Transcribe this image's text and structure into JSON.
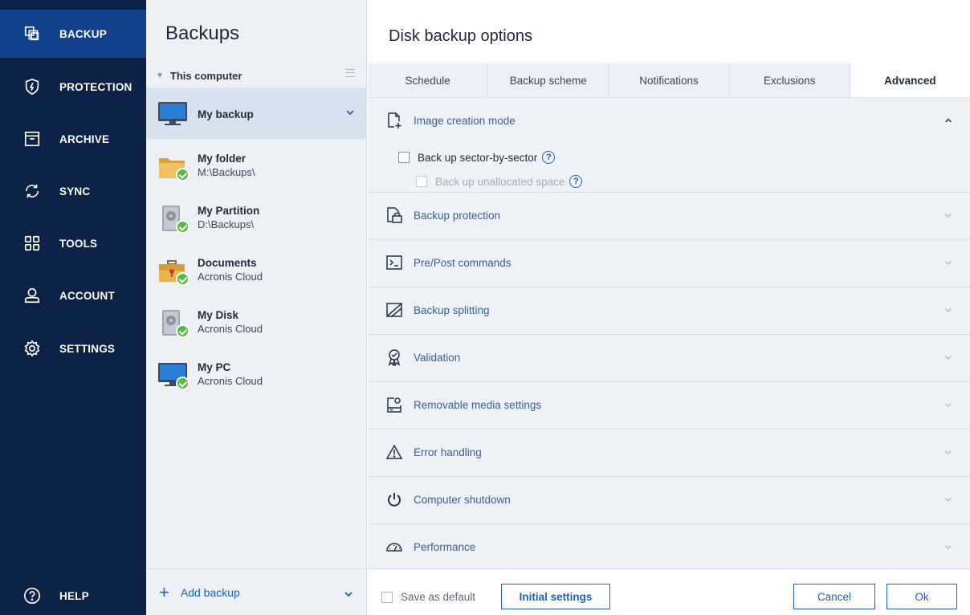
{
  "nav": {
    "items": [
      {
        "label": "BACKUP",
        "icon": "backup-icon"
      },
      {
        "label": "PROTECTION",
        "icon": "shield-icon"
      },
      {
        "label": "ARCHIVE",
        "icon": "archive-box-icon"
      },
      {
        "label": "SYNC",
        "icon": "sync-icon"
      },
      {
        "label": "TOOLS",
        "icon": "tools-grid-icon"
      },
      {
        "label": "ACCOUNT",
        "icon": "user-icon"
      },
      {
        "label": "SETTINGS",
        "icon": "gear-icon"
      }
    ],
    "help": {
      "label": "HELP",
      "icon": "help-circle-icon"
    }
  },
  "backups": {
    "title": "Backups",
    "group": "This computer",
    "items": [
      {
        "name": "My backup",
        "sub": "",
        "type": "monitor"
      },
      {
        "name": "My folder",
        "sub": "M:\\Backups\\",
        "type": "folder"
      },
      {
        "name": "My Partition",
        "sub": "D:\\Backups\\",
        "type": "disk"
      },
      {
        "name": "Documents",
        "sub": "Acronis Cloud",
        "type": "briefcase"
      },
      {
        "name": "My Disk",
        "sub": "Acronis Cloud",
        "type": "disk"
      },
      {
        "name": "My PC",
        "sub": "Acronis Cloud",
        "type": "monitor"
      }
    ],
    "add_label": "Add backup"
  },
  "panel": {
    "title": "Disk backup options",
    "tabs": [
      "Schedule",
      "Backup scheme",
      "Notifications",
      "Exclusions",
      "Advanced"
    ],
    "active_tab": "Advanced",
    "sections": [
      {
        "label": "Image creation mode",
        "icon": "image-add-icon"
      },
      {
        "label": "Backup protection",
        "icon": "lock-file-icon"
      },
      {
        "label": "Pre/Post commands",
        "icon": "terminal-icon"
      },
      {
        "label": "Backup splitting",
        "icon": "split-icon"
      },
      {
        "label": "Validation",
        "icon": "validation-ribbon-icon"
      },
      {
        "label": "Removable media settings",
        "icon": "removable-media-icon"
      },
      {
        "label": "Error handling",
        "icon": "warning-icon"
      },
      {
        "label": "Computer shutdown",
        "icon": "power-icon"
      },
      {
        "label": "Performance",
        "icon": "speedometer-icon"
      }
    ],
    "image_mode": {
      "sector_by_sector": "Back up sector-by-sector",
      "unallocated": "Back up unallocated space"
    },
    "help_glyph": "?"
  },
  "footer": {
    "save_default": "Save as default",
    "initial_settings": "Initial settings",
    "cancel": "Cancel",
    "ok": "Ok"
  },
  "colors": {
    "nav_bg": "#0c2247",
    "nav_active": "#12408a",
    "accent": "#1e5fb8",
    "success": "#58b947"
  }
}
